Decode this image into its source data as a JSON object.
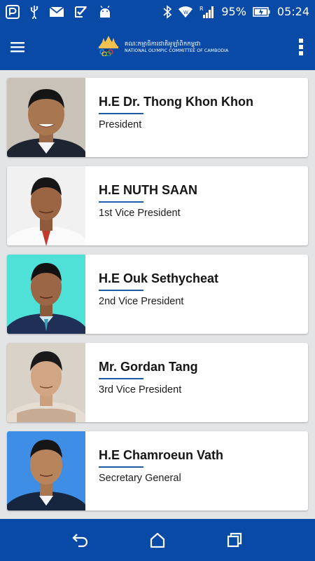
{
  "status_bar": {
    "battery_percent": "95%",
    "time": "05:24",
    "icons": [
      "pushbullet-icon",
      "usb-icon",
      "mail-icon",
      "checkmark-icon",
      "android-icon",
      "bluetooth-icon",
      "wifi-icon",
      "signal-icon",
      "battery-icon"
    ]
  },
  "app_bar": {
    "logo_khmer": "គណៈកម្មាធិការជាតិអូឡាំពិកកម្ពុជា",
    "logo_english": "NATIONAL OLYMPIC COMMITTEE OF CAMBODIA",
    "menu_icon": "hamburger-menu-icon",
    "overflow_icon": "more-vert-icon"
  },
  "members": [
    {
      "name": "H.E Dr. Thong Khon Khon",
      "title": "President",
      "photo_bg": "#c9c2b8"
    },
    {
      "name": "H.E NUTH SAAN",
      "title": "1st Vice President",
      "photo_bg": "#f1f1f1"
    },
    {
      "name": "H.E Ouk Sethycheat",
      "title": "2nd Vice President",
      "photo_bg": "#4fe0d8"
    },
    {
      "name": "Mr. Gordan Tang",
      "title": "3rd Vice President",
      "photo_bg": "#d9d2c8"
    },
    {
      "name": "H.E Chamroeun Vath",
      "title": "Secretary General",
      "photo_bg": "#3f8ee6"
    }
  ],
  "nav_bar": {
    "icons": [
      "back-icon",
      "home-icon",
      "recent-apps-icon"
    ]
  },
  "colors": {
    "primary": "#0a4aa7",
    "background": "#e3e4e6",
    "accent_rule": "#1d5aa8"
  }
}
